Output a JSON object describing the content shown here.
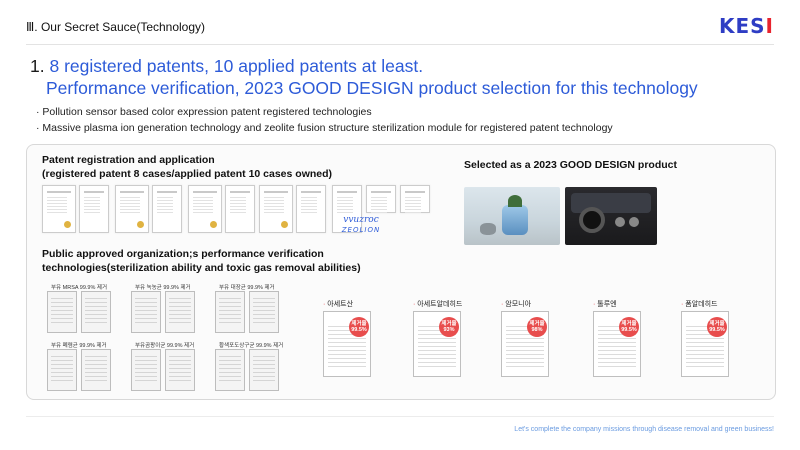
{
  "header": {
    "section_title": "Ⅲ. Our Secret Sauce(Technology)",
    "logo_text": [
      "K",
      "E",
      "S",
      "I"
    ]
  },
  "headline": {
    "number": "1.",
    "line1": "8 registered patents, 10 applied patents at least.",
    "line2": "Performance verification, 2023 GOOD DESIGN product selection for this technology"
  },
  "bullets": [
    "· Pollution sensor based color expression patent registered technologies",
    "· Massive plasma ion generation technology and zeolite fusion structure sterilization module for registered patent technology"
  ],
  "patent": {
    "title_line1": "Patent registration and application",
    "title_line2": "(registered patent 8 cases/applied patent 10 cases owned)",
    "brand1": "vvuzroc",
    "brand2": "ZEOLION"
  },
  "gooddesign": {
    "title": "Selected as a 2023 GOOD DESIGN product"
  },
  "verification": {
    "title_line1": "Public approved organization;s performance verification",
    "title_line2": "technologies(sterilization ability and toxic gas removal abilities)",
    "certs": [
      "부유 MRSA 99.9% 제거",
      "부유 녹농균 99.9% 제거",
      "부유 대장균 99.9% 제거",
      "부유 폐렴균 99.9% 제거",
      "부유곰팡이균 99.9% 제거",
      "황색포도상구균 99.9% 제거"
    ],
    "reports": [
      {
        "name": "아세트산",
        "badge": "제거율 99.5%"
      },
      {
        "name": "아세트알데히드",
        "badge": "제거율 93%"
      },
      {
        "name": "암모니아",
        "badge": "제거율 98%"
      },
      {
        "name": "톨루엔",
        "badge": "제거율 99.5%"
      },
      {
        "name": "폼알데히드",
        "badge": "제거율 99.5%"
      }
    ]
  },
  "footer": {
    "text": "Let's complete the company missions through disease removal and green business!"
  },
  "colors": {
    "brand_blue": "#2e3dc4",
    "brand_red": "#e8232e",
    "headline_blue": "#2d5bd8",
    "footer_blue": "#6a9be0"
  }
}
